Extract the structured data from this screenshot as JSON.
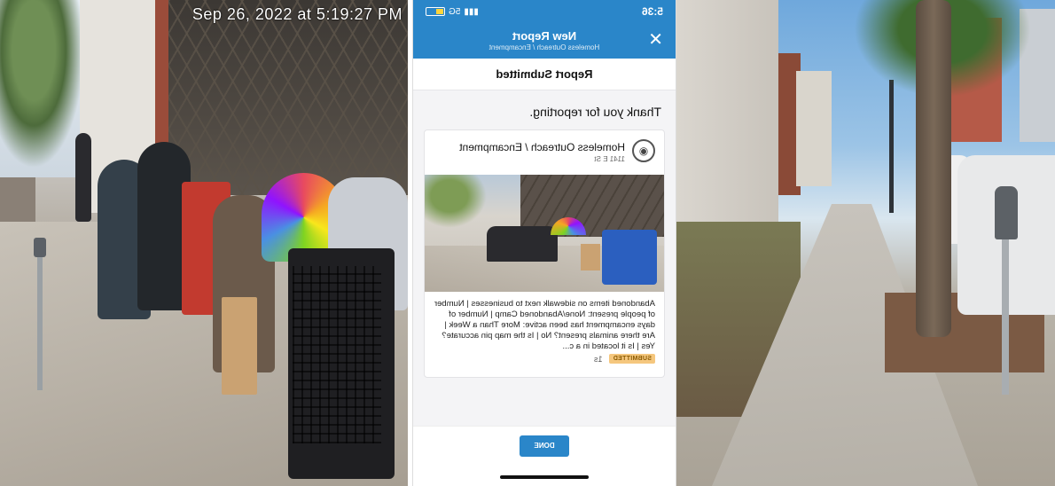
{
  "left_photo": {
    "timestamp": "Sep 26, 2022 at 5:19:27 PM"
  },
  "phone": {
    "status_bar": {
      "time": "5:36",
      "network": "5G"
    },
    "header": {
      "title": "New Report",
      "subtitle": "Homeless Outreach / Encampment",
      "close_icon": "close-icon"
    },
    "subheader": "Report Submitted",
    "thanks": "Thank you for reporting.",
    "report_card": {
      "icon": "map-pin-eye-icon",
      "title": "Homeless Outreach / Encampment",
      "address": "1141 E St",
      "description": "Abandoned items on sidewalk next to businesses | Number of people present: None/Abandoned Camp | Number of days encampment has been active: More Than a Week | Are there animals present? No | Is the map pin accurate? Yes | Is it located in a c...",
      "status_badge": "SUBMITTED",
      "age": "1s"
    },
    "done_button": "DONE",
    "colors": {
      "accent": "#2a86c9",
      "badge_bg": "#f5c77e",
      "badge_text": "#8a5a00"
    }
  }
}
